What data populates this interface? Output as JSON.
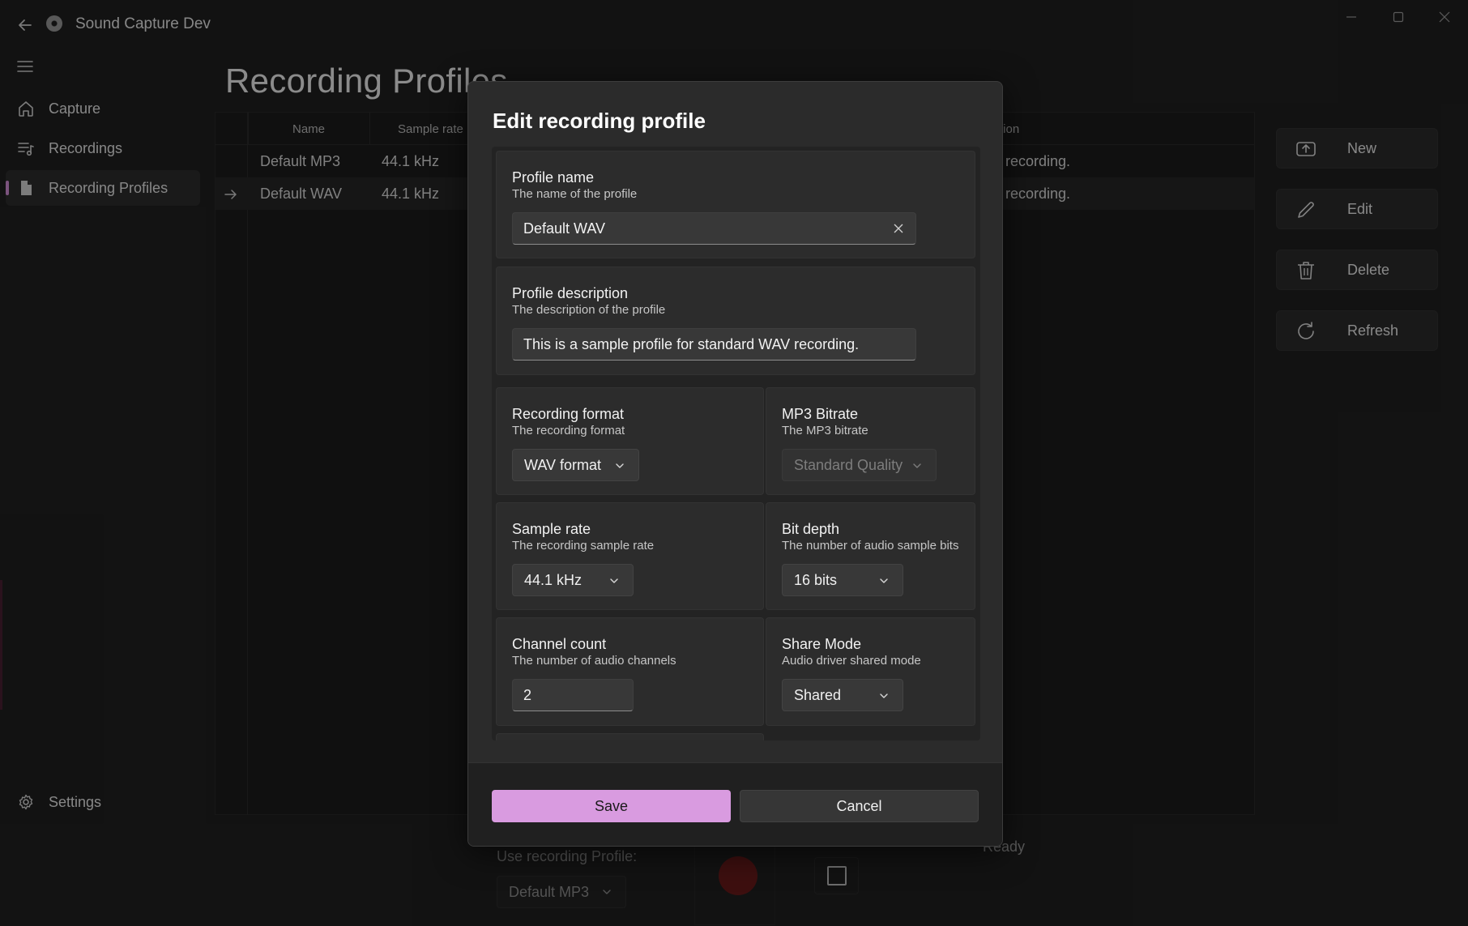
{
  "window": {
    "title": "Sound Capture Dev",
    "back_icon": "back-arrow-icon",
    "controls": [
      "minimize-icon",
      "maximize-icon",
      "close-icon"
    ]
  },
  "nav": {
    "items": [
      {
        "label": "Capture",
        "icon": "home-icon"
      },
      {
        "label": "Recordings",
        "icon": "music-list-icon"
      },
      {
        "label": "Recording Profiles",
        "icon": "document-icon",
        "selected": true
      }
    ],
    "footer": {
      "label": "Settings",
      "icon": "gear-icon"
    }
  },
  "page": {
    "title": "Recording Profiles",
    "table": {
      "columns": [
        "Name",
        "Sample rate",
        "tion"
      ],
      "rows": [
        {
          "name": "Default MP3",
          "sample_rate": "44.1 kHz",
          "description": "recording."
        },
        {
          "name": "Default WAV",
          "sample_rate": "44.1 kHz",
          "description": "recording.",
          "selected": true
        }
      ]
    },
    "actions": [
      {
        "label": "New",
        "icon": "upload-box-icon"
      },
      {
        "label": "Edit",
        "icon": "pencil-icon"
      },
      {
        "label": "Delete",
        "icon": "trash-icon"
      },
      {
        "label": "Refresh",
        "icon": "refresh-icon"
      }
    ]
  },
  "bottom": {
    "profile_label": "Use recording Profile:",
    "profile_value": "Default MP3",
    "status": "Ready"
  },
  "dialog": {
    "title": "Edit recording profile",
    "profile_name": {
      "title": "Profile name",
      "subtitle": "The name of the profile",
      "value": "Default WAV"
    },
    "profile_description": {
      "title": "Profile description",
      "subtitle": "The description of the profile",
      "value": "This is a sample profile for standard WAV recording."
    },
    "recording_format": {
      "title": "Recording format",
      "subtitle": "The recording format",
      "value": "WAV format"
    },
    "mp3_bitrate": {
      "title": "MP3 Bitrate",
      "subtitle": "The MP3 bitrate",
      "value": "Standard Quality",
      "disabled": true
    },
    "sample_rate": {
      "title": "Sample rate",
      "subtitle": "The recording sample rate",
      "value": "44.1 kHz"
    },
    "bit_depth": {
      "title": "Bit depth",
      "subtitle": "The number of audio sample bits",
      "value": "16 bits"
    },
    "channel_count": {
      "title": "Channel count",
      "subtitle": "The number of audio channels",
      "value": "2"
    },
    "share_mode": {
      "title": "Share Mode",
      "subtitle": "Audio driver shared mode",
      "value": "Shared"
    },
    "save_label": "Save",
    "cancel_label": "Cancel"
  },
  "colors": {
    "accent": "#d99be0",
    "background": "#202020",
    "record": "#6a1a1a"
  }
}
